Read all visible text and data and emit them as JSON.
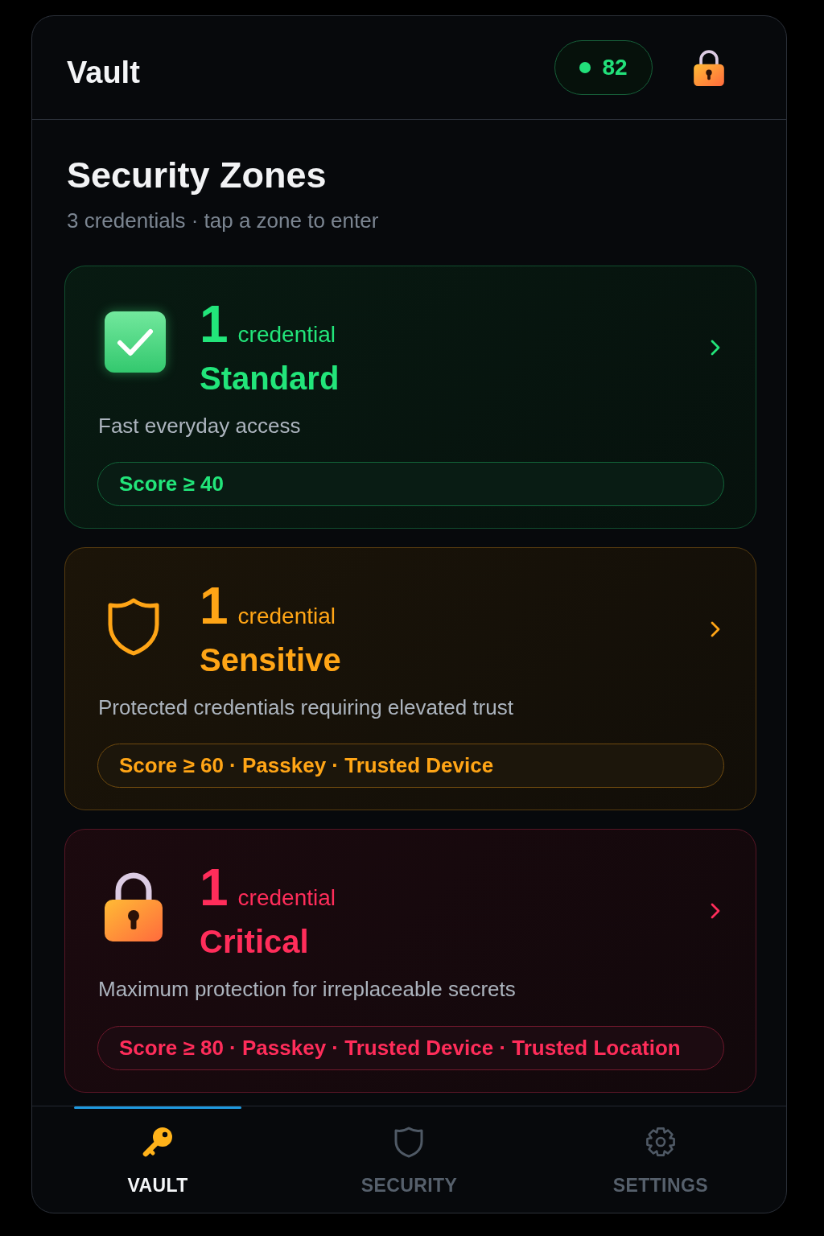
{
  "header": {
    "title": "Vault",
    "score": "82"
  },
  "intro": {
    "title": "Security Zones",
    "subtitle": "3 credentials · tap a zone to enter"
  },
  "zones": [
    {
      "kind": "check",
      "color": "#22e57a",
      "count": "1",
      "unit": "credential",
      "name": "Standard",
      "description": "Fast everyday access",
      "requirements": "Score ≥ 40"
    },
    {
      "kind": "shield",
      "color": "#ffa516",
      "count": "1",
      "unit": "credential",
      "name": "Sensitive",
      "description": "Protected credentials requiring elevated trust",
      "requirements": "Score ≥ 60 · Passkey · Trusted Device"
    },
    {
      "kind": "lock",
      "color": "#ff2d5a",
      "count": "1",
      "unit": "credential",
      "name": "Critical",
      "description": "Maximum protection for irreplaceable secrets",
      "requirements": "Score ≥ 80 · Passkey · Trusted Device · Trusted Location"
    }
  ],
  "nav": [
    {
      "kind": "key",
      "label": "VAULT",
      "selected": true
    },
    {
      "kind": "shield",
      "label": "SECURITY",
      "selected": false
    },
    {
      "kind": "gear",
      "label": "SETTINGS",
      "selected": false
    }
  ]
}
